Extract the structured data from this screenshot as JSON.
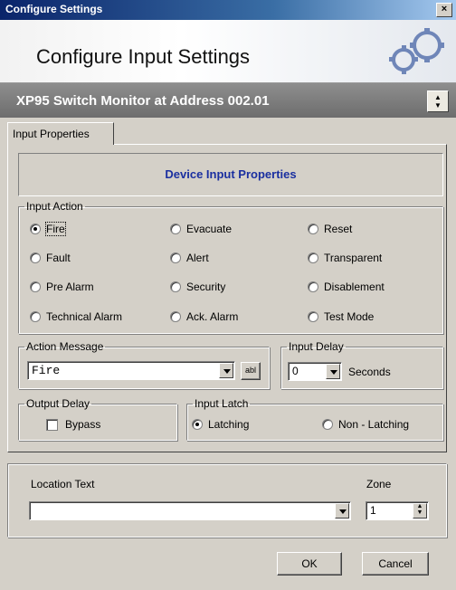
{
  "window": {
    "title": "Configure Settings",
    "close_glyph": "×"
  },
  "banner": {
    "heading": "Configure Input Settings",
    "logo_icon": "gears-logo"
  },
  "device": {
    "title": "XP95 Switch Monitor at Address 002.01"
  },
  "tabs": [
    {
      "label": "Input Properties",
      "active": true
    }
  ],
  "panel": {
    "title": "Device Input Properties"
  },
  "input_action": {
    "legend": "Input Action",
    "selected": "Fire",
    "options": [
      "Fire",
      "Evacuate",
      "Reset",
      "Fault",
      "Alert",
      "Transparent",
      "Pre Alarm",
      "Security",
      "Disablement",
      "Technical Alarm",
      "Ack. Alarm",
      "Test Mode"
    ]
  },
  "action_message": {
    "legend": "Action Message",
    "value": "Fire",
    "edit_button": "abl"
  },
  "input_delay": {
    "legend": "Input Delay",
    "value": "0",
    "unit": "Seconds"
  },
  "output_delay": {
    "legend": "Output Delay",
    "bypass_label": "Bypass",
    "bypass_checked": false
  },
  "input_latch": {
    "legend": "Input Latch",
    "options": [
      "Latching",
      "Non - Latching"
    ],
    "selected": "Latching"
  },
  "location": {
    "label": "Location Text",
    "value": ""
  },
  "zone": {
    "label": "Zone",
    "value": "1"
  },
  "buttons": {
    "ok": "OK",
    "cancel": "Cancel"
  },
  "colors": {
    "title_bar": "#0a246a",
    "device_bar": "#7a7a7a",
    "panel_title": "#1a2fa0",
    "face": "#d4d0c8"
  }
}
